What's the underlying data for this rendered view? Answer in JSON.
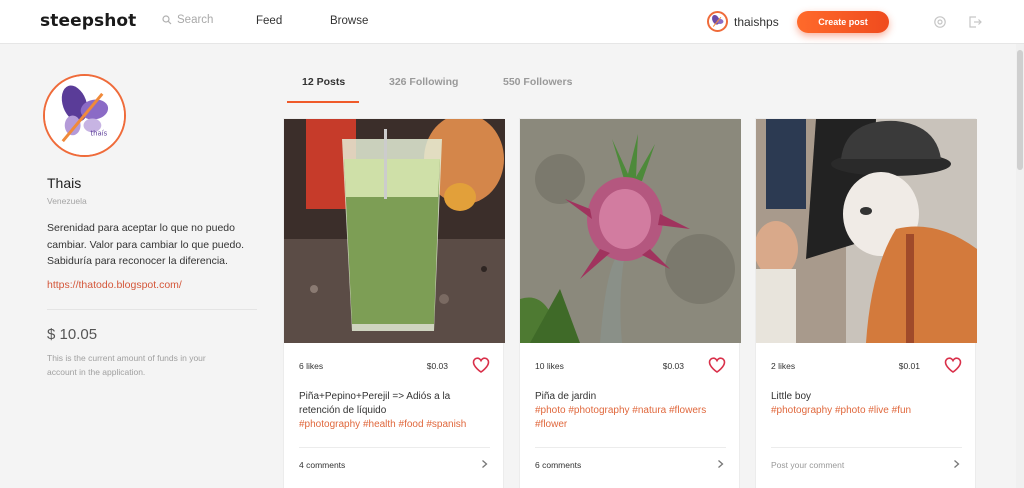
{
  "header": {
    "logo": "steepshot",
    "search_placeholder": "Search",
    "nav_feed": "Feed",
    "nav_browse": "Browse",
    "username": "thaishps",
    "create_post": "Create post",
    "icons": [
      "search-icon",
      "gear-icon",
      "logout-icon"
    ]
  },
  "profile": {
    "name": "Thais",
    "location": "Venezuela",
    "bio": "Serenidad para aceptar lo que no puedo cambiar. Valor para cambiar lo que puedo. Sabiduría para reconocer la diferencia.",
    "link": "https://thatodo.blogspot.com/",
    "balance": "$ 10.05",
    "balance_note": "This is the current amount of funds in your account in the application."
  },
  "tabs": {
    "posts": "12 Posts",
    "following": "326 Following",
    "followers": "550 Followers"
  },
  "posts": [
    {
      "likes": "6 likes",
      "payout": "$0.03",
      "title": "Piña+Pepino+Perejil => Adiós a la retención de líquido",
      "tags": "#photography #health #food #spanish",
      "comments": "4 comments"
    },
    {
      "likes": "10 likes",
      "payout": "$0.03",
      "title": "Piña de jardin",
      "tags": "#photo #photography #natura #flowers #flower",
      "comments": "6 comments"
    },
    {
      "likes": "2 likes",
      "payout": "$0.01",
      "title": "Little boy",
      "tags": "#photography #photo #live #fun",
      "comments": "Post your comment"
    }
  ],
  "colors": {
    "accent": "#ef5a2a",
    "tag": "#e0683d",
    "heart": "#d9304a"
  }
}
